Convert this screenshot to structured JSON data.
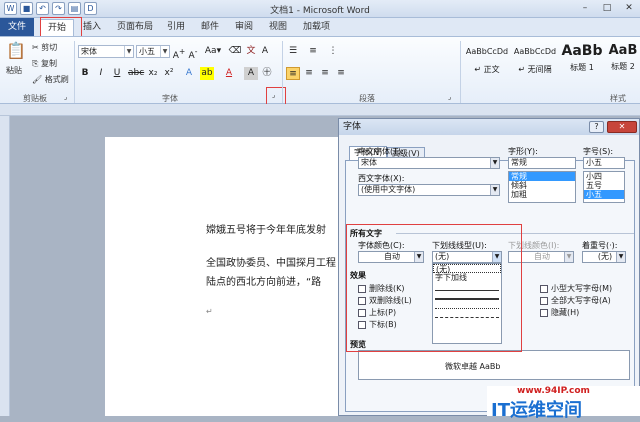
{
  "window": {
    "title": "文档1 - Microsoft Word"
  },
  "tabs": {
    "file": "文件",
    "home": "开始",
    "insert": "插入",
    "layout": "页面布局",
    "ref": "引用",
    "mail": "邮件",
    "review": "审阅",
    "view": "视图",
    "addins": "加载项"
  },
  "clipboard": {
    "paste": "粘贴",
    "cut": "剪切",
    "copy": "复制",
    "painter": "格式刷",
    "group": "剪贴板"
  },
  "font": {
    "name": "宋体",
    "size": "小五",
    "group": "字体"
  },
  "para": {
    "group": "段落"
  },
  "styles": {
    "group": "样式",
    "items": [
      {
        "preview": "AaBbCcDd",
        "name": "↵ 正文"
      },
      {
        "preview": "AaBbCcDd",
        "name": "↵ 无间隔"
      },
      {
        "preview": "AaBb",
        "name": "标题 1"
      },
      {
        "preview": "AaB",
        "name": "标题 2"
      }
    ]
  },
  "doc": {
    "line1": "嫦娥五号将于今年年底发射",
    "line2": "全国政协委员、中国探月工程",
    "line3": "陆点的西北方向前进，“路",
    "mark": "↵"
  },
  "dialog": {
    "title": "字体",
    "help": "?",
    "close": "✕",
    "tab_font": "字体(N)",
    "tab_adv": "高级(V)",
    "cn_font_label": "中文字体(T):",
    "cn_font_value": "宋体",
    "west_font_label": "西文字体(X):",
    "west_font_value": "(使用中文字体)",
    "style_label": "字形(Y):",
    "style_value": "常规",
    "style_list": [
      "常规",
      "倾斜",
      "加粗"
    ],
    "size_label": "字号(S):",
    "size_value": "小五",
    "size_list": [
      "小四",
      "五号",
      "小五"
    ],
    "all_text": "所有文字",
    "color_label": "字体颜色(C):",
    "color_value": "自动",
    "uline_label": "下划线线型(U):",
    "uline_value": "(无)",
    "uline_list_none": "(无)",
    "uline_list_word": "字下加线",
    "ucolor_label": "下划线颜色(I):",
    "ucolor_value": "自动",
    "emph_label": "着重号(·):",
    "emph_value": "(无)",
    "effects": "效果",
    "strike": "删除线(K)",
    "dstrike": "双删除线(L)",
    "sup": "上标(P)",
    "sub": "下标(B)",
    "smallcaps": "小型大写字母(M)",
    "allcaps": "全部大写字母(A)",
    "hidden": "隐藏(H)",
    "preview": "预览",
    "preview_text": "微软卓越 AaBb"
  },
  "watermark": {
    "url": "www.94IP.com",
    "brand": "IT运维空间"
  },
  "colors": {
    "accent": "#2b579a",
    "red": "#e04040",
    "brand": "#1a6fd1"
  }
}
